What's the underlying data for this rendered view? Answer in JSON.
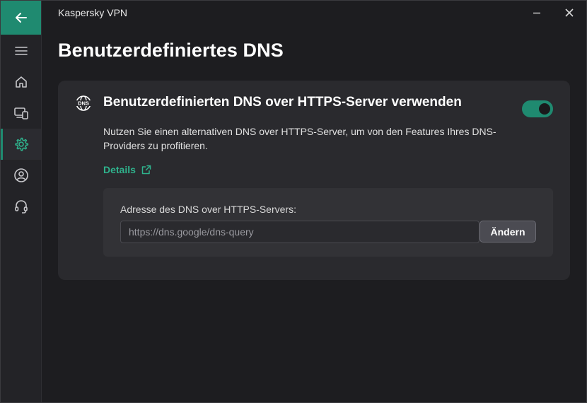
{
  "app": {
    "title": "Kaspersky VPN"
  },
  "window_controls": {
    "minimize_icon": "minimize-icon",
    "close_icon": "close-icon"
  },
  "sidebar": {
    "back_icon": "arrow-left-icon",
    "items": [
      {
        "icon": "menu-icon",
        "name": "menu"
      },
      {
        "icon": "home-icon",
        "name": "home"
      },
      {
        "icon": "devices-icon",
        "name": "devices"
      },
      {
        "icon": "gear-icon",
        "name": "settings",
        "active": true
      },
      {
        "icon": "user-icon",
        "name": "profile"
      },
      {
        "icon": "headset-icon",
        "name": "support"
      }
    ]
  },
  "page": {
    "title": "Benutzerdefiniertes DNS"
  },
  "card": {
    "icon": "dns-icon",
    "icon_text": "DNS",
    "title": "Benutzerdefinierten DNS over HTTPS-Server verwenden",
    "toggle_on": true,
    "description": "Nutzen Sie einen alternativen DNS over HTTPS-Server, um von den Features Ihres DNS-Providers zu profitieren.",
    "details_label": "Details",
    "details_icon": "external-link-icon",
    "address_label": "Adresse des DNS over HTTPS-Servers:",
    "address_value": "https://dns.google/dns-query",
    "change_label": "Ändern"
  },
  "colors": {
    "accent": "#1f8a70",
    "link": "#2fb38d",
    "background": "#1d1d20",
    "card": "#2a2a2e"
  }
}
